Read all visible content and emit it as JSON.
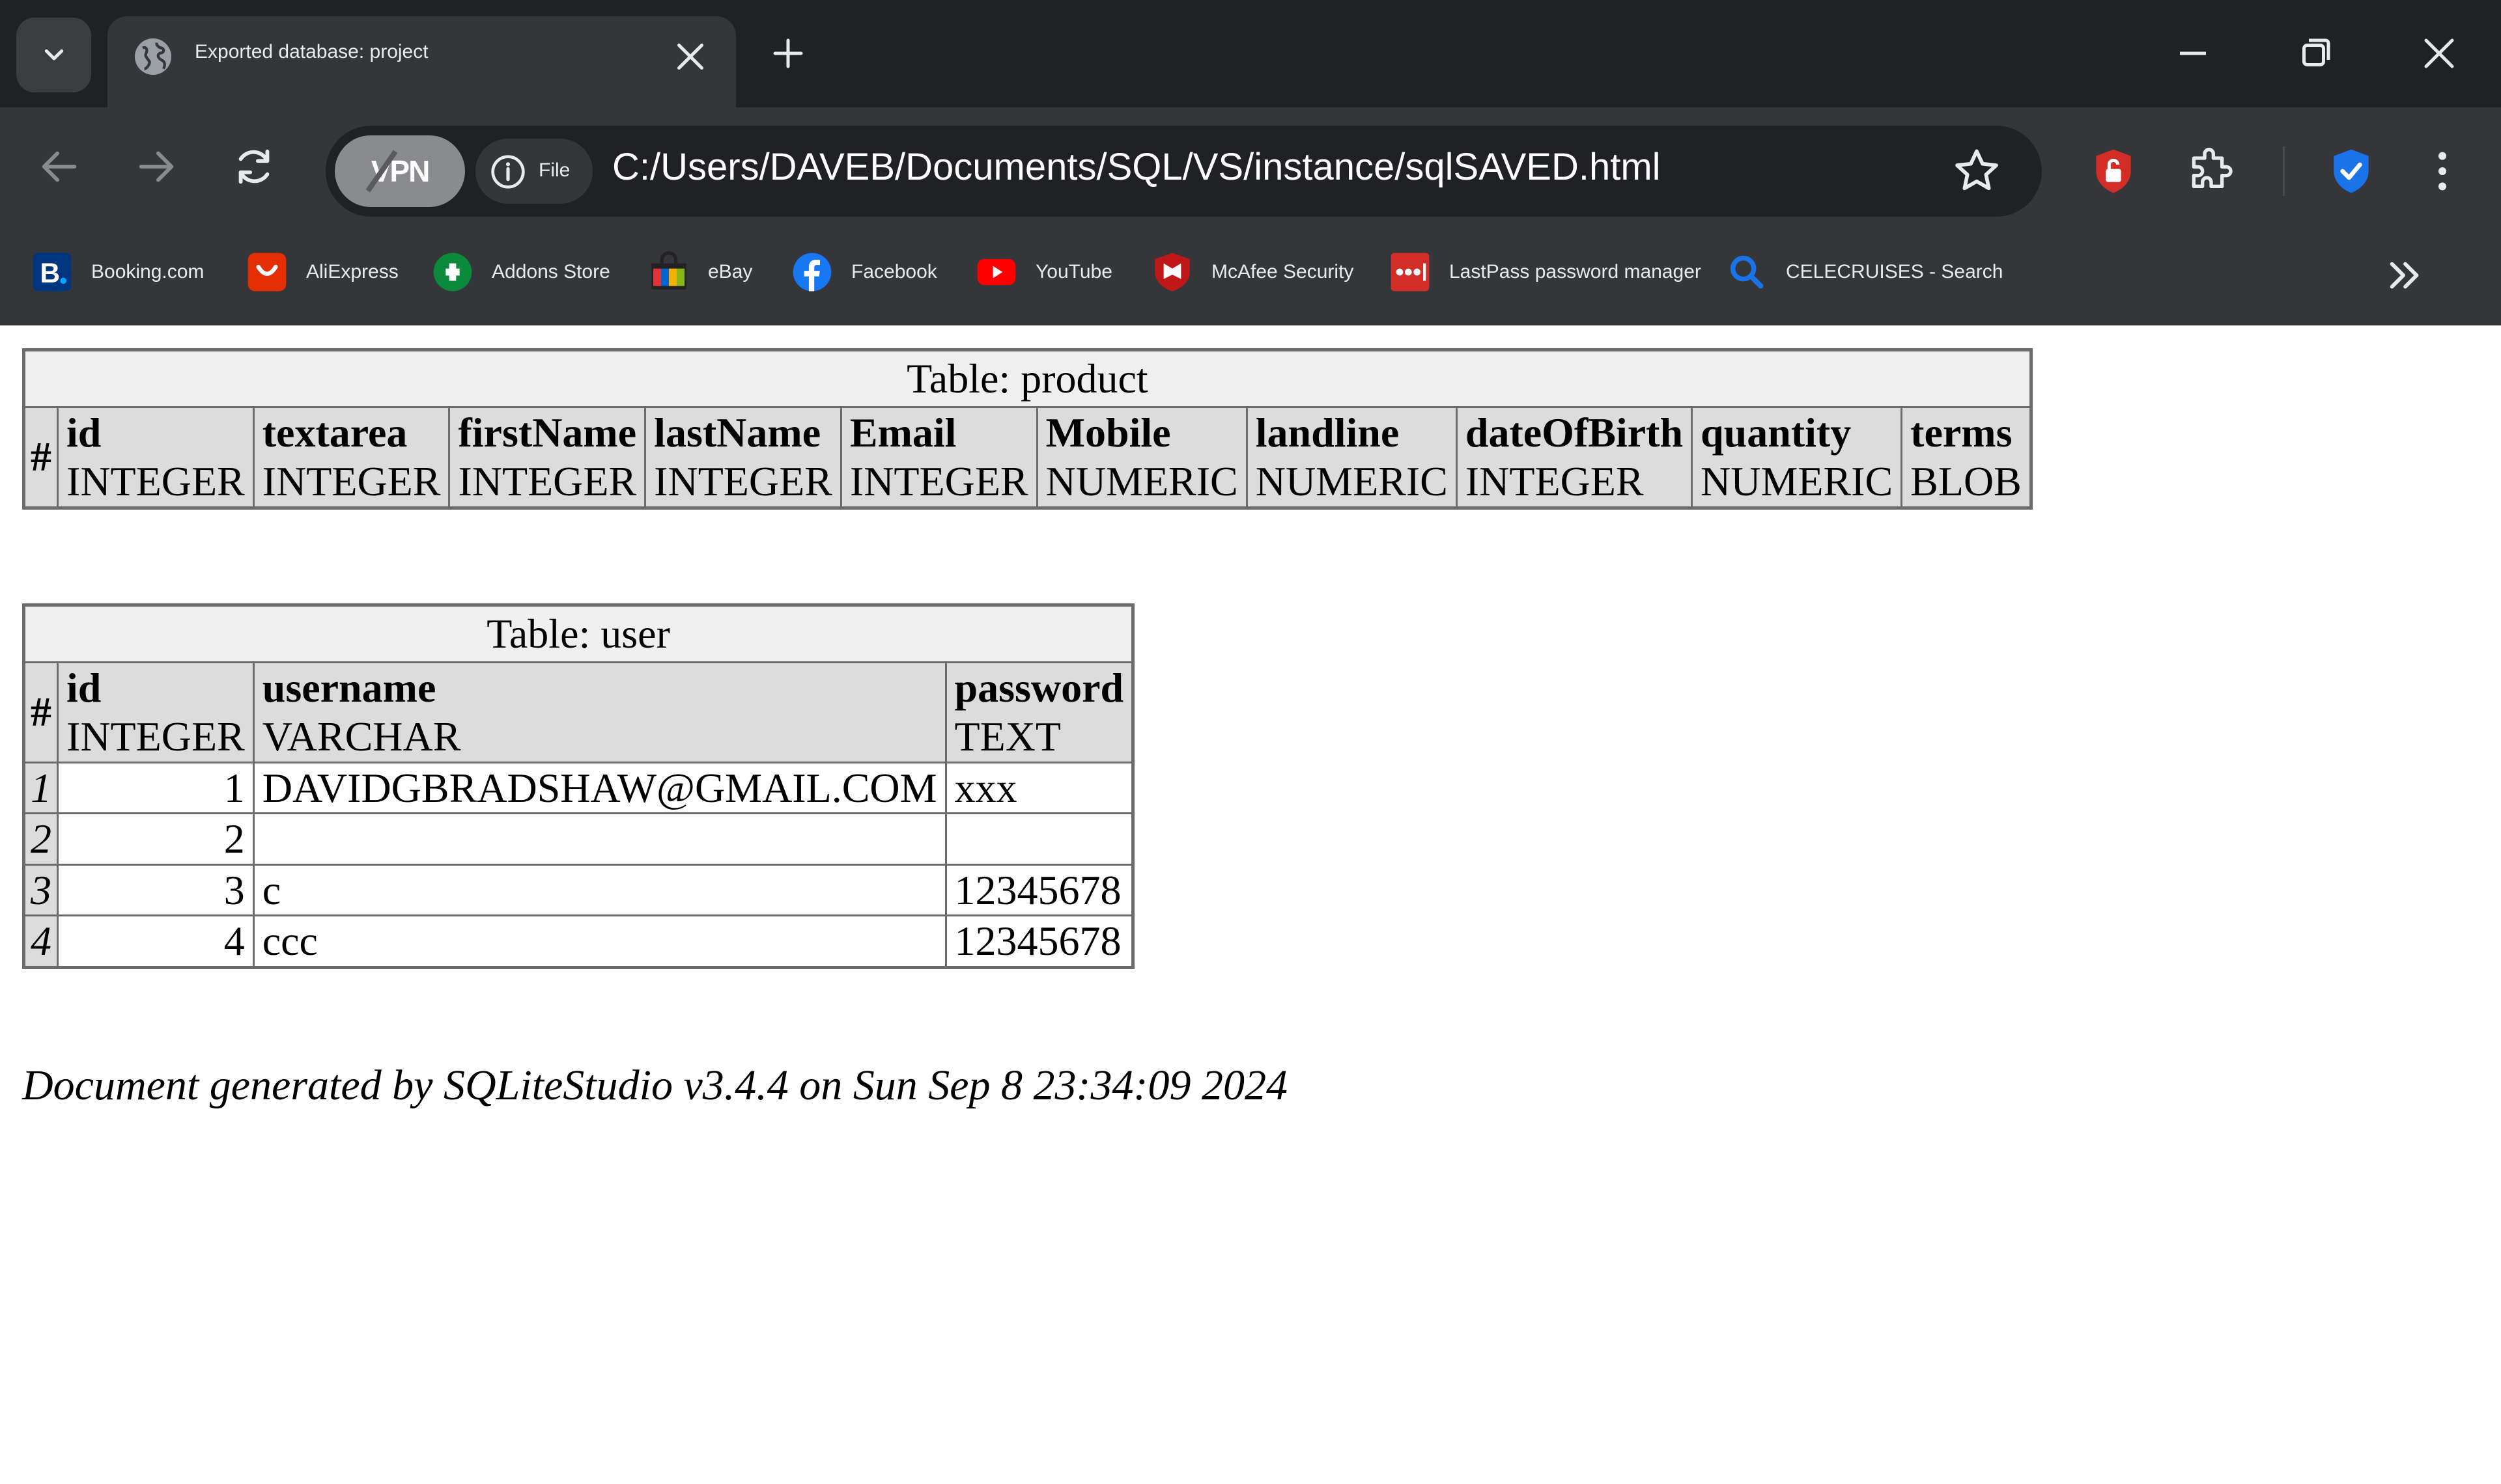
{
  "browser": {
    "tab": {
      "title": "Exported database: project"
    },
    "toolbar": {
      "vpn_label": "VPN",
      "file_chip_label": "File",
      "url": "C:/Users/DAVEB/Documents/SQL/VS/instance/sqlSAVED.html"
    },
    "bookmarks": [
      {
        "label": "Booking.com",
        "icon": "booking-icon",
        "color": "#003580"
      },
      {
        "label": "AliExpress",
        "icon": "aliexpress-icon",
        "color": "#e62e04"
      },
      {
        "label": "Addons Store",
        "icon": "addons-icon",
        "color": "#0a8a3a"
      },
      {
        "label": "eBay",
        "icon": "ebay-icon",
        "color": "#e53238"
      },
      {
        "label": "Facebook",
        "icon": "facebook-icon",
        "color": "#1877f2"
      },
      {
        "label": "YouTube",
        "icon": "youtube-icon",
        "color": "#ff0000"
      },
      {
        "label": "McAfee Security",
        "icon": "mcafee-icon",
        "color": "#c01818"
      },
      {
        "label": "LastPass password manager",
        "icon": "lastpass-icon",
        "color": "#d32d27"
      },
      {
        "label": "CELECRUISES - Search",
        "icon": "search-icon",
        "color": "#1a73e8"
      }
    ]
  },
  "content": {
    "product_table": {
      "caption": "Table: product",
      "hash": "#",
      "columns": [
        {
          "name": "id",
          "type": "INTEGER"
        },
        {
          "name": "textarea",
          "type": "INTEGER"
        },
        {
          "name": "firstName",
          "type": "INTEGER"
        },
        {
          "name": "lastName",
          "type": "INTEGER"
        },
        {
          "name": "Email",
          "type": "INTEGER"
        },
        {
          "name": "Mobile",
          "type": "NUMERIC"
        },
        {
          "name": "landline",
          "type": "NUMERIC"
        },
        {
          "name": "dateOfBirth",
          "type": "INTEGER"
        },
        {
          "name": "quantity",
          "type": "NUMERIC"
        },
        {
          "name": "terms",
          "type": "BLOB"
        }
      ]
    },
    "user_table": {
      "caption": "Table: user",
      "hash": "#",
      "columns": [
        {
          "name": "id",
          "type": "INTEGER"
        },
        {
          "name": "username",
          "type": "VARCHAR"
        },
        {
          "name": "password",
          "type": "TEXT"
        }
      ],
      "rows": [
        {
          "num": "1",
          "id": "1",
          "username": "DAVIDGBRADSHAW@GMAIL.COM",
          "password": "xxx"
        },
        {
          "num": "2",
          "id": "2",
          "username": "",
          "password": ""
        },
        {
          "num": "3",
          "id": "3",
          "username": "c",
          "password": "12345678"
        },
        {
          "num": "4",
          "id": "4",
          "username": "ccc",
          "password": "12345678"
        }
      ]
    },
    "footer": "Document generated by SQLiteStudio v3.4.4 on Sun Sep 8 23:34:09 2024"
  }
}
